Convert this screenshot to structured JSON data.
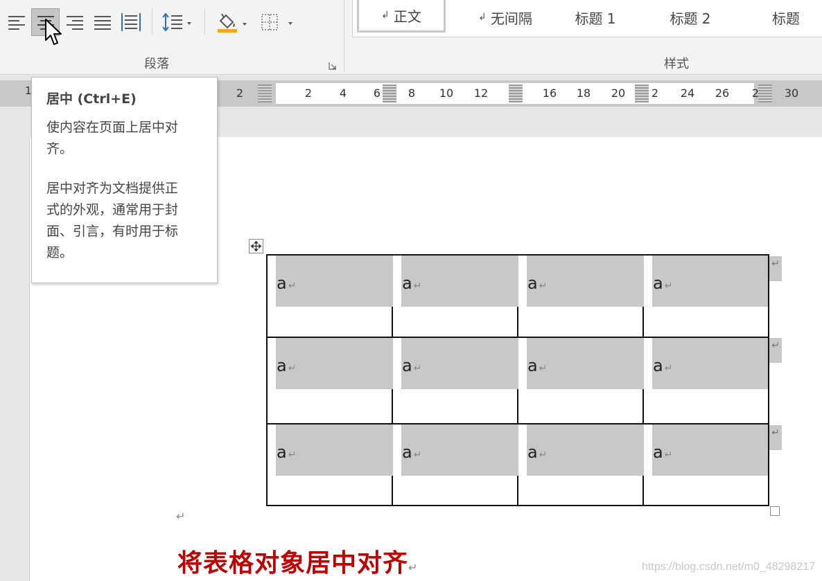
{
  "ribbon": {
    "paragraph_group_label": "段落",
    "styles_group_label": "样式",
    "buttons": {
      "align_left": "align-left-icon",
      "align_center": "align-center-icon",
      "align_right": "align-right-icon",
      "justify": "justify-icon",
      "distributed": "distributed-icon",
      "line_spacing": "line-spacing-icon",
      "shading": "paint-bucket-icon",
      "borders": "borders-icon"
    },
    "styles": [
      {
        "mark": "↲",
        "label": "正文"
      },
      {
        "mark": "↲",
        "label": "无间隔"
      },
      {
        "mark": "",
        "label": "标题 1"
      },
      {
        "mark": "",
        "label": "标题 2"
      },
      {
        "mark": "",
        "label": "标题"
      }
    ]
  },
  "ruler": {
    "left_label": "1",
    "numbers": [
      "2",
      "2",
      "4",
      "6",
      "8",
      "10",
      "12",
      "16",
      "18",
      "20",
      "2",
      "24",
      "26",
      "2",
      "30"
    ]
  },
  "tooltip": {
    "title": "居中 (Ctrl+E)",
    "line1": "使内容在页面上居中对",
    "line2": "齐。",
    "line3": "居中对齐为文档提供正",
    "line4": "式的外观，通常用于封",
    "line5": "面、引言，有时用于标",
    "line6": "题。"
  },
  "table": {
    "rows": [
      [
        "a",
        "a",
        "a",
        "a"
      ],
      [
        "a",
        "a",
        "a",
        "a"
      ],
      [
        "a",
        "a",
        "a",
        "a"
      ]
    ],
    "cell_mark": "↵",
    "row_end_mark": "↵"
  },
  "document": {
    "paragraph_mark": "↵",
    "caption": "将表格对象居中对齐",
    "caption_mark": "↵"
  },
  "watermark": "https://blog.csdn.net/m0_48298217",
  "colors": {
    "caption": "#c00000",
    "cell_shading": "#c8c8c8"
  }
}
